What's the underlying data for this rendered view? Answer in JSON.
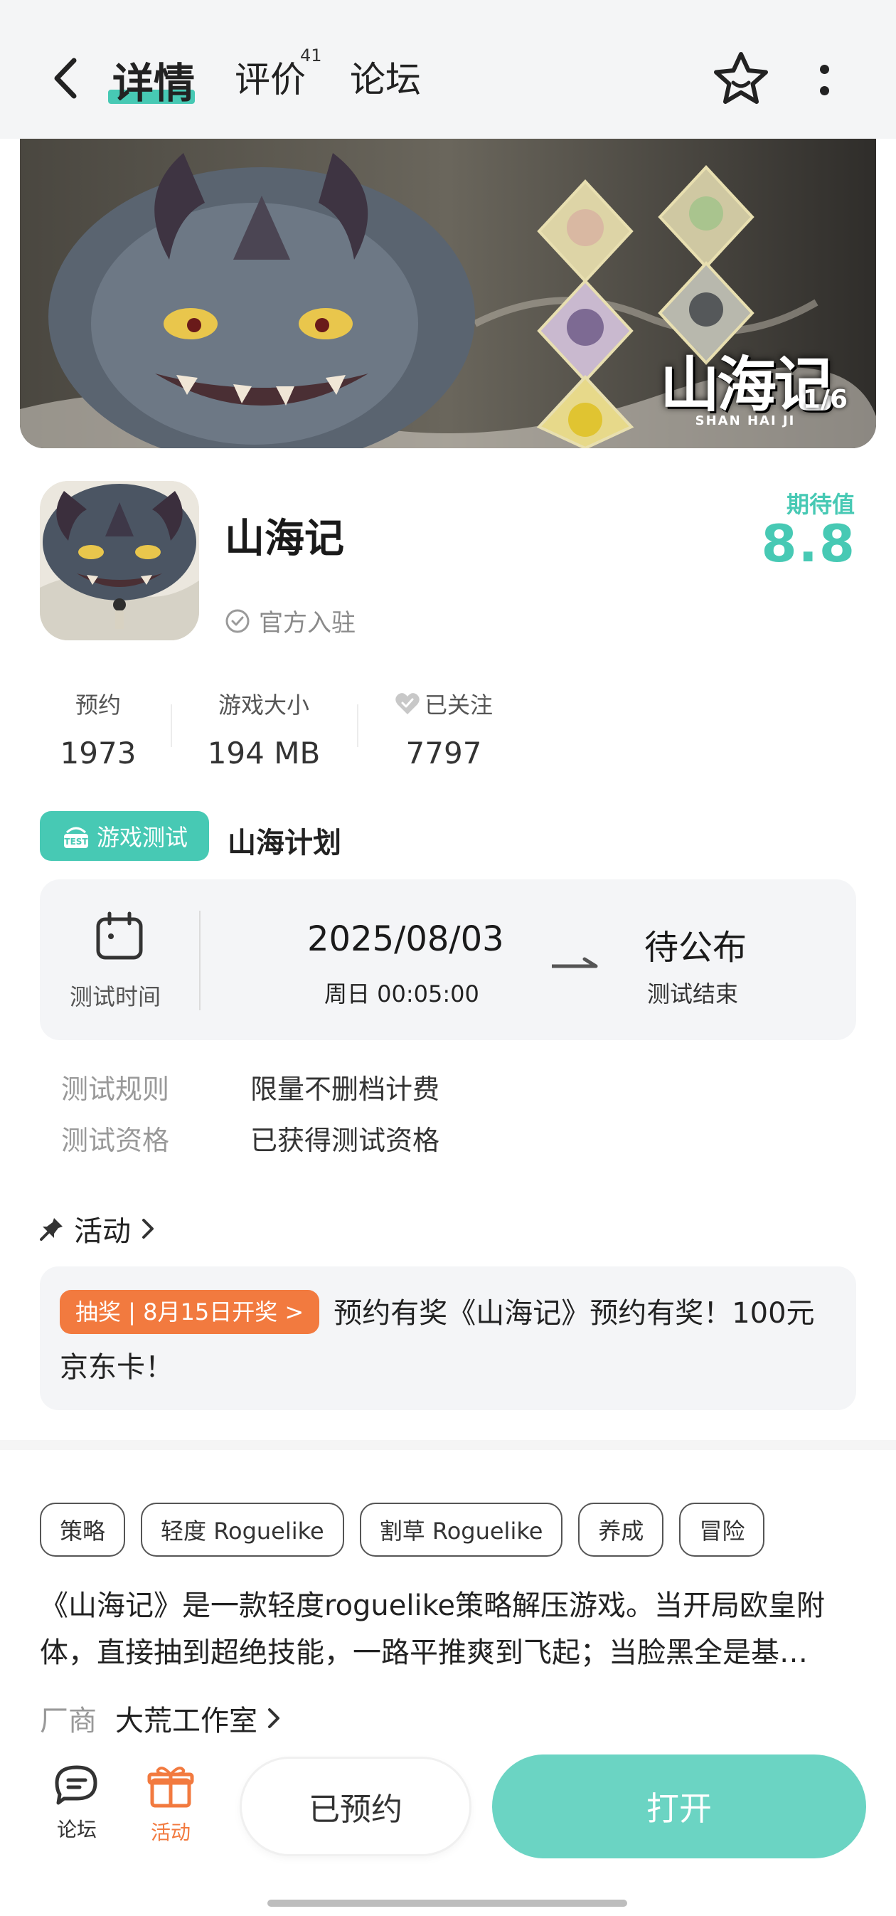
{
  "header": {
    "tabs": [
      {
        "label": "详情",
        "active": true
      },
      {
        "label": "评价",
        "badge": "41"
      },
      {
        "label": "论坛"
      }
    ],
    "back_icon": "chevron-left-icon",
    "favorite_icon": "star-outline-icon",
    "more_icon": "more-vertical-icon"
  },
  "banner": {
    "logo_title": "山海记",
    "logo_subtitle": "SHAN HAI JI",
    "counter": "1/6"
  },
  "game": {
    "title": "山海记",
    "official_label": "官方入驻",
    "expect_label": "期待值",
    "expect_score": "8.8"
  },
  "stats": [
    {
      "label": "预约",
      "value": "1973"
    },
    {
      "label": "游戏大小",
      "value": "194 MB"
    },
    {
      "label": "已关注",
      "value": "7797",
      "icon": "heart-check-icon"
    }
  ],
  "test": {
    "badge_label": "游戏测试",
    "plan_name": "山海计划",
    "time_label": "测试时间",
    "start_date": "2025/08/03",
    "start_time": "周日  00:05:00",
    "end_value": "待公布",
    "end_label": "测试结束",
    "rules": [
      {
        "label": "测试规则",
        "value": "限量不删档计费"
      },
      {
        "label": "测试资格",
        "value": "已获得测试资格"
      }
    ]
  },
  "activity": {
    "heading": "活动",
    "pill": "抽奖 | 8月15日开奖 >",
    "text": "预约有奖《山海记》预约有奖！100元京东卡！"
  },
  "tags": [
    "策略",
    "轻度 Roguelike",
    "割草 Roguelike",
    "养成",
    "冒险"
  ],
  "description": {
    "line1": "《山海记》是一款轻度roguelike策略解压游戏。当开局欧皇附",
    "line2": "体，直接抽到超绝技能，一路平推爽到飞起；当脸黑全是基…"
  },
  "vendor": {
    "label": "厂商",
    "name": "大荒工作室"
  },
  "bottom_bar": {
    "forum_label": "论坛",
    "activity_label": "活动",
    "reserved_label": "已预约",
    "open_label": "打开"
  },
  "colors": {
    "accent": "#47c9b4",
    "open_button": "#6bd4c3",
    "activity_pill": "#f27a3f",
    "activity_tab": "#f27a3f"
  }
}
